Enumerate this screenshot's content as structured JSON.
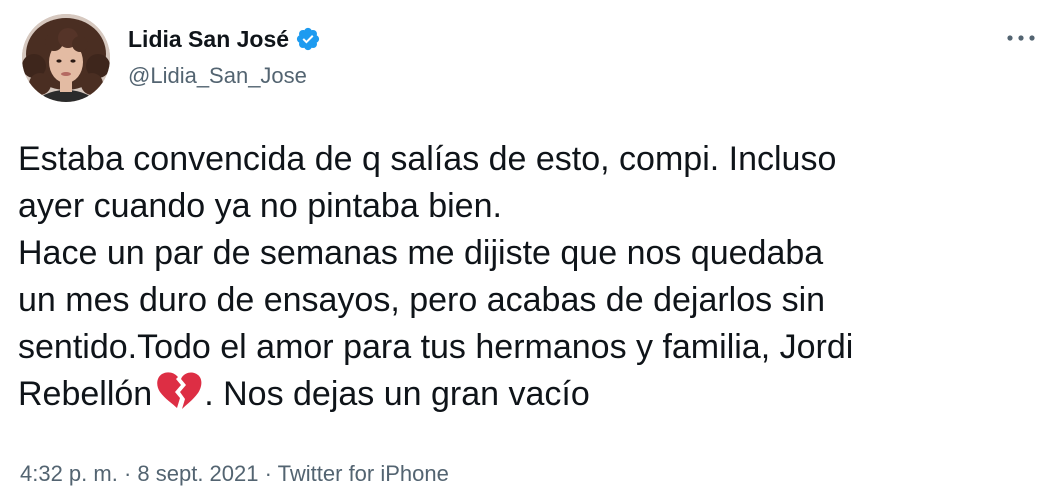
{
  "author": {
    "display_name": "Lidia San José",
    "handle": "@Lidia_San_Jose",
    "verified": true,
    "verified_color": "#1d9bf0"
  },
  "more_button_icon": "more-horizontal-icon",
  "tweet": {
    "lines": [
      "Estaba convencida de q salías de esto, compi. Incluso",
      "ayer cuando ya no pintaba bien.",
      "Hace un par de semanas me dijiste que nos quedaba",
      "un mes duro de ensayos, pero acabas de dejarlos sin",
      "sentido.Todo el amor para tus hermanos y familia, Jordi"
    ],
    "last_line_before_emoji": "Rebellón",
    "emoji": "broken-heart-icon",
    "last_line_after_emoji": ". Nos dejas un gran vacío"
  },
  "meta": {
    "time": "4:32 p. m.",
    "separator": " · ",
    "date": "8 sept. 2021",
    "source": "Twitter for iPhone"
  },
  "colors": {
    "text": "#0f1419",
    "secondary": "#536471",
    "emoji_red": "#dd2e44"
  }
}
